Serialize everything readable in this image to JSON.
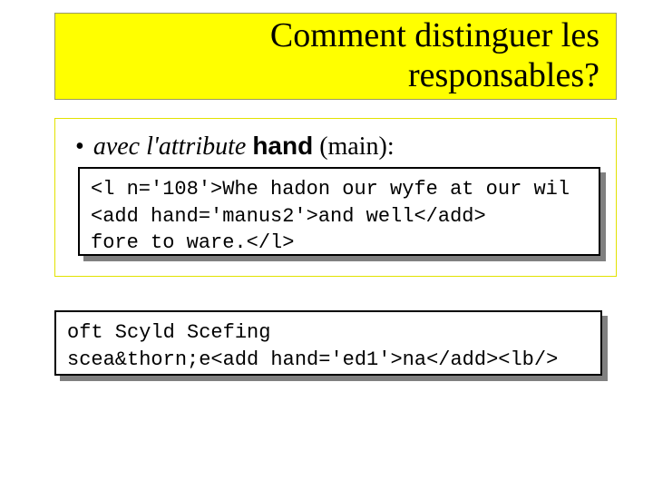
{
  "title": {
    "line1": "Comment distinguer les",
    "line2": "responsables?"
  },
  "bullet": {
    "prefix": "avec l'attribute",
    "hand_word": "hand",
    "paren": "(main):"
  },
  "code1": {
    "line1": "<l n='108'>Whe hadon our wyfe at our wil",
    "line2": "<add hand='manus2'>and well</add>",
    "line3": "fore to ware.</l>"
  },
  "code2": {
    "line1": "oft Scyld Scefing",
    "line2": "scea&thorn;e<add hand='ed1'>na</add><lb/>"
  }
}
